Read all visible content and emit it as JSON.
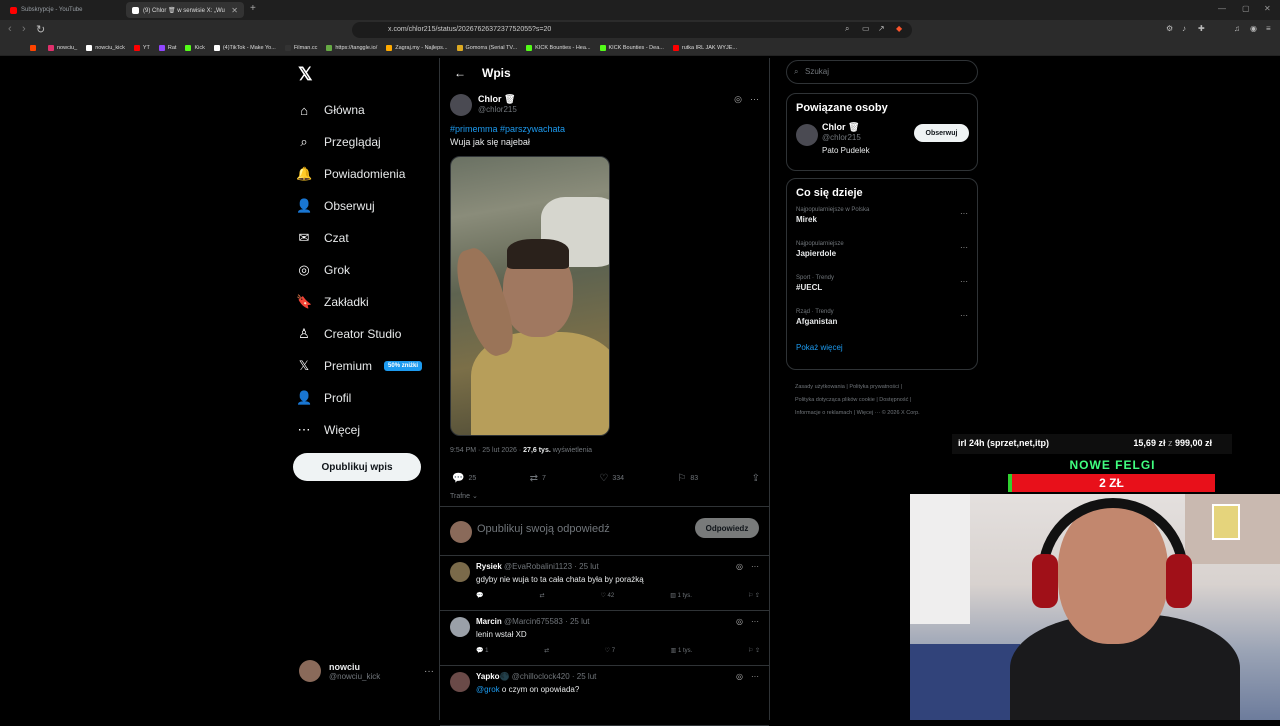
{
  "browser": {
    "tabs": [
      {
        "title": "Subskrypcje - YouTube",
        "color": "#ff0000"
      },
      {
        "title": "(9) Chlor 🗑 w serwisie X: „Wu",
        "color": "#ffffff"
      }
    ],
    "url": "x.com/chlor215/status/2026762637237752055?s=20",
    "bookmarks": [
      {
        "label": "",
        "color": "#ff4400"
      },
      {
        "label": "nowciu_",
        "color": "#e1306c"
      },
      {
        "label": "nowciu_kick",
        "color": "#ffffff"
      },
      {
        "label": "YT",
        "color": "#ff0000"
      },
      {
        "label": "Rat",
        "color": "#9146ff"
      },
      {
        "label": "Kick",
        "color": "#53fc18"
      },
      {
        "label": "(4)TikTok - Make Yo...",
        "color": "#ffffff"
      },
      {
        "label": "Filman.cc",
        "color": "#333333"
      },
      {
        "label": "https://tanggle.io/",
        "color": "#66aa44"
      },
      {
        "label": "Zagraj.my - Najleps...",
        "color": "#ffaa00"
      },
      {
        "label": "Gomorra (Serial TV...",
        "color": "#ddaa22"
      },
      {
        "label": "KICK Bounties - Hea...",
        "color": "#53fc18"
      },
      {
        "label": "KICK Bounties - Dea...",
        "color": "#53fc18"
      },
      {
        "label": "rutka IRL JAK WYJE...",
        "color": "#ff0000"
      }
    ]
  },
  "nav": {
    "items": [
      {
        "icon": "⌂",
        "name": "home",
        "label": "Główna"
      },
      {
        "icon": "⌕",
        "name": "explore",
        "label": "Przeglądaj"
      },
      {
        "icon": "🔔",
        "name": "notifications",
        "label": "Powiadomienia"
      },
      {
        "icon": "👤",
        "name": "follow",
        "label": "Obserwuj"
      },
      {
        "icon": "✉",
        "name": "chat",
        "label": "Czat"
      },
      {
        "icon": "◎",
        "name": "grok",
        "label": "Grok"
      },
      {
        "icon": "🔖",
        "name": "bookmarks",
        "label": "Zakładki"
      },
      {
        "icon": "♙",
        "name": "creator-studio",
        "label": "Creator Studio"
      },
      {
        "icon": "𝕏",
        "name": "premium",
        "label": "Premium"
      },
      {
        "icon": "👤",
        "name": "profile",
        "label": "Profil"
      },
      {
        "icon": "⋯",
        "name": "more",
        "label": "Więcej"
      }
    ],
    "promo": "50% zniżki",
    "post_button": "Opublikuj wpis",
    "account": {
      "name": "nowciu",
      "handle": "@nowciu_kick"
    }
  },
  "header": {
    "title": "Wpis"
  },
  "tweet": {
    "author": "Chlor 🗑",
    "handle": "@chlor215",
    "hashtags": "#primemma #parszywachata",
    "text": "Wuja jak się najebał",
    "time": "9:54 PM · 25 lut 2026 · ",
    "views": "27,6 tys.",
    "views_label": " wyświetlenia",
    "replies": "25",
    "reposts": "7",
    "likes": "334",
    "bookmarks": "83",
    "sort": "Trafne"
  },
  "reply_box": {
    "placeholder": "Opublikuj swoją odpowiedź",
    "button": "Odpowiedz"
  },
  "replies": [
    {
      "name": "Rysiek",
      "handle": "@EvaRobalini1123 · 25 lut",
      "text": "gdyby nie wuja to ta cała chata była by porażką",
      "mention": "",
      "replies": "",
      "likes": "42",
      "views": "1 tys."
    },
    {
      "name": "Marcin",
      "handle": "@Marcin675583 · 25 lut",
      "text": "lenin wstał XD",
      "mention": "",
      "replies": "1",
      "likes": "7",
      "views": "1 tys."
    },
    {
      "name": "Yapko🌑",
      "handle": "@chilloclock420 · 25 lut",
      "text": " o czym on opowiada?",
      "mention": "@grok",
      "replies": "",
      "likes": "",
      "views": ""
    }
  ],
  "search": {
    "placeholder": "Szukaj"
  },
  "related": {
    "title": "Powiązane osoby",
    "name": "Chlor 🗑",
    "handle": "@chlor215",
    "bio": "Pato Pudelek",
    "follow_label": "Obserwuj"
  },
  "trends": {
    "title": "Co się dzieje",
    "items": [
      {
        "category": "Najpopularniejsze w Polska",
        "topic": "Mirek"
      },
      {
        "category": "Najpopularniejsze",
        "topic": "Japierdole"
      },
      {
        "category": "Sport · Trendy",
        "topic": "#UECL"
      },
      {
        "category": "Rząd · Trendy",
        "topic": "Afganistan"
      }
    ],
    "show_more": "Pokaż więcej"
  },
  "footer": {
    "line1": "Zasady użytkowania  |  Polityka prywatności  |",
    "line2": "Polityka dotycząca plików cookie  |  Dostępność  |",
    "line3": "Informacje o reklamach  |  Więcej ···  © 2026 X Corp."
  },
  "overlay": {
    "goal_label": "irl 24h (sprzet,net,itp)",
    "goal_current": "15,69 zł",
    "goal_sep": " z ",
    "goal_target": "999,00 zł",
    "goal_fraction": 0.016,
    "promo_title": "NOWE FELGI",
    "promo_value": "2 ZŁ",
    "bar_fraction": 0.02
  }
}
